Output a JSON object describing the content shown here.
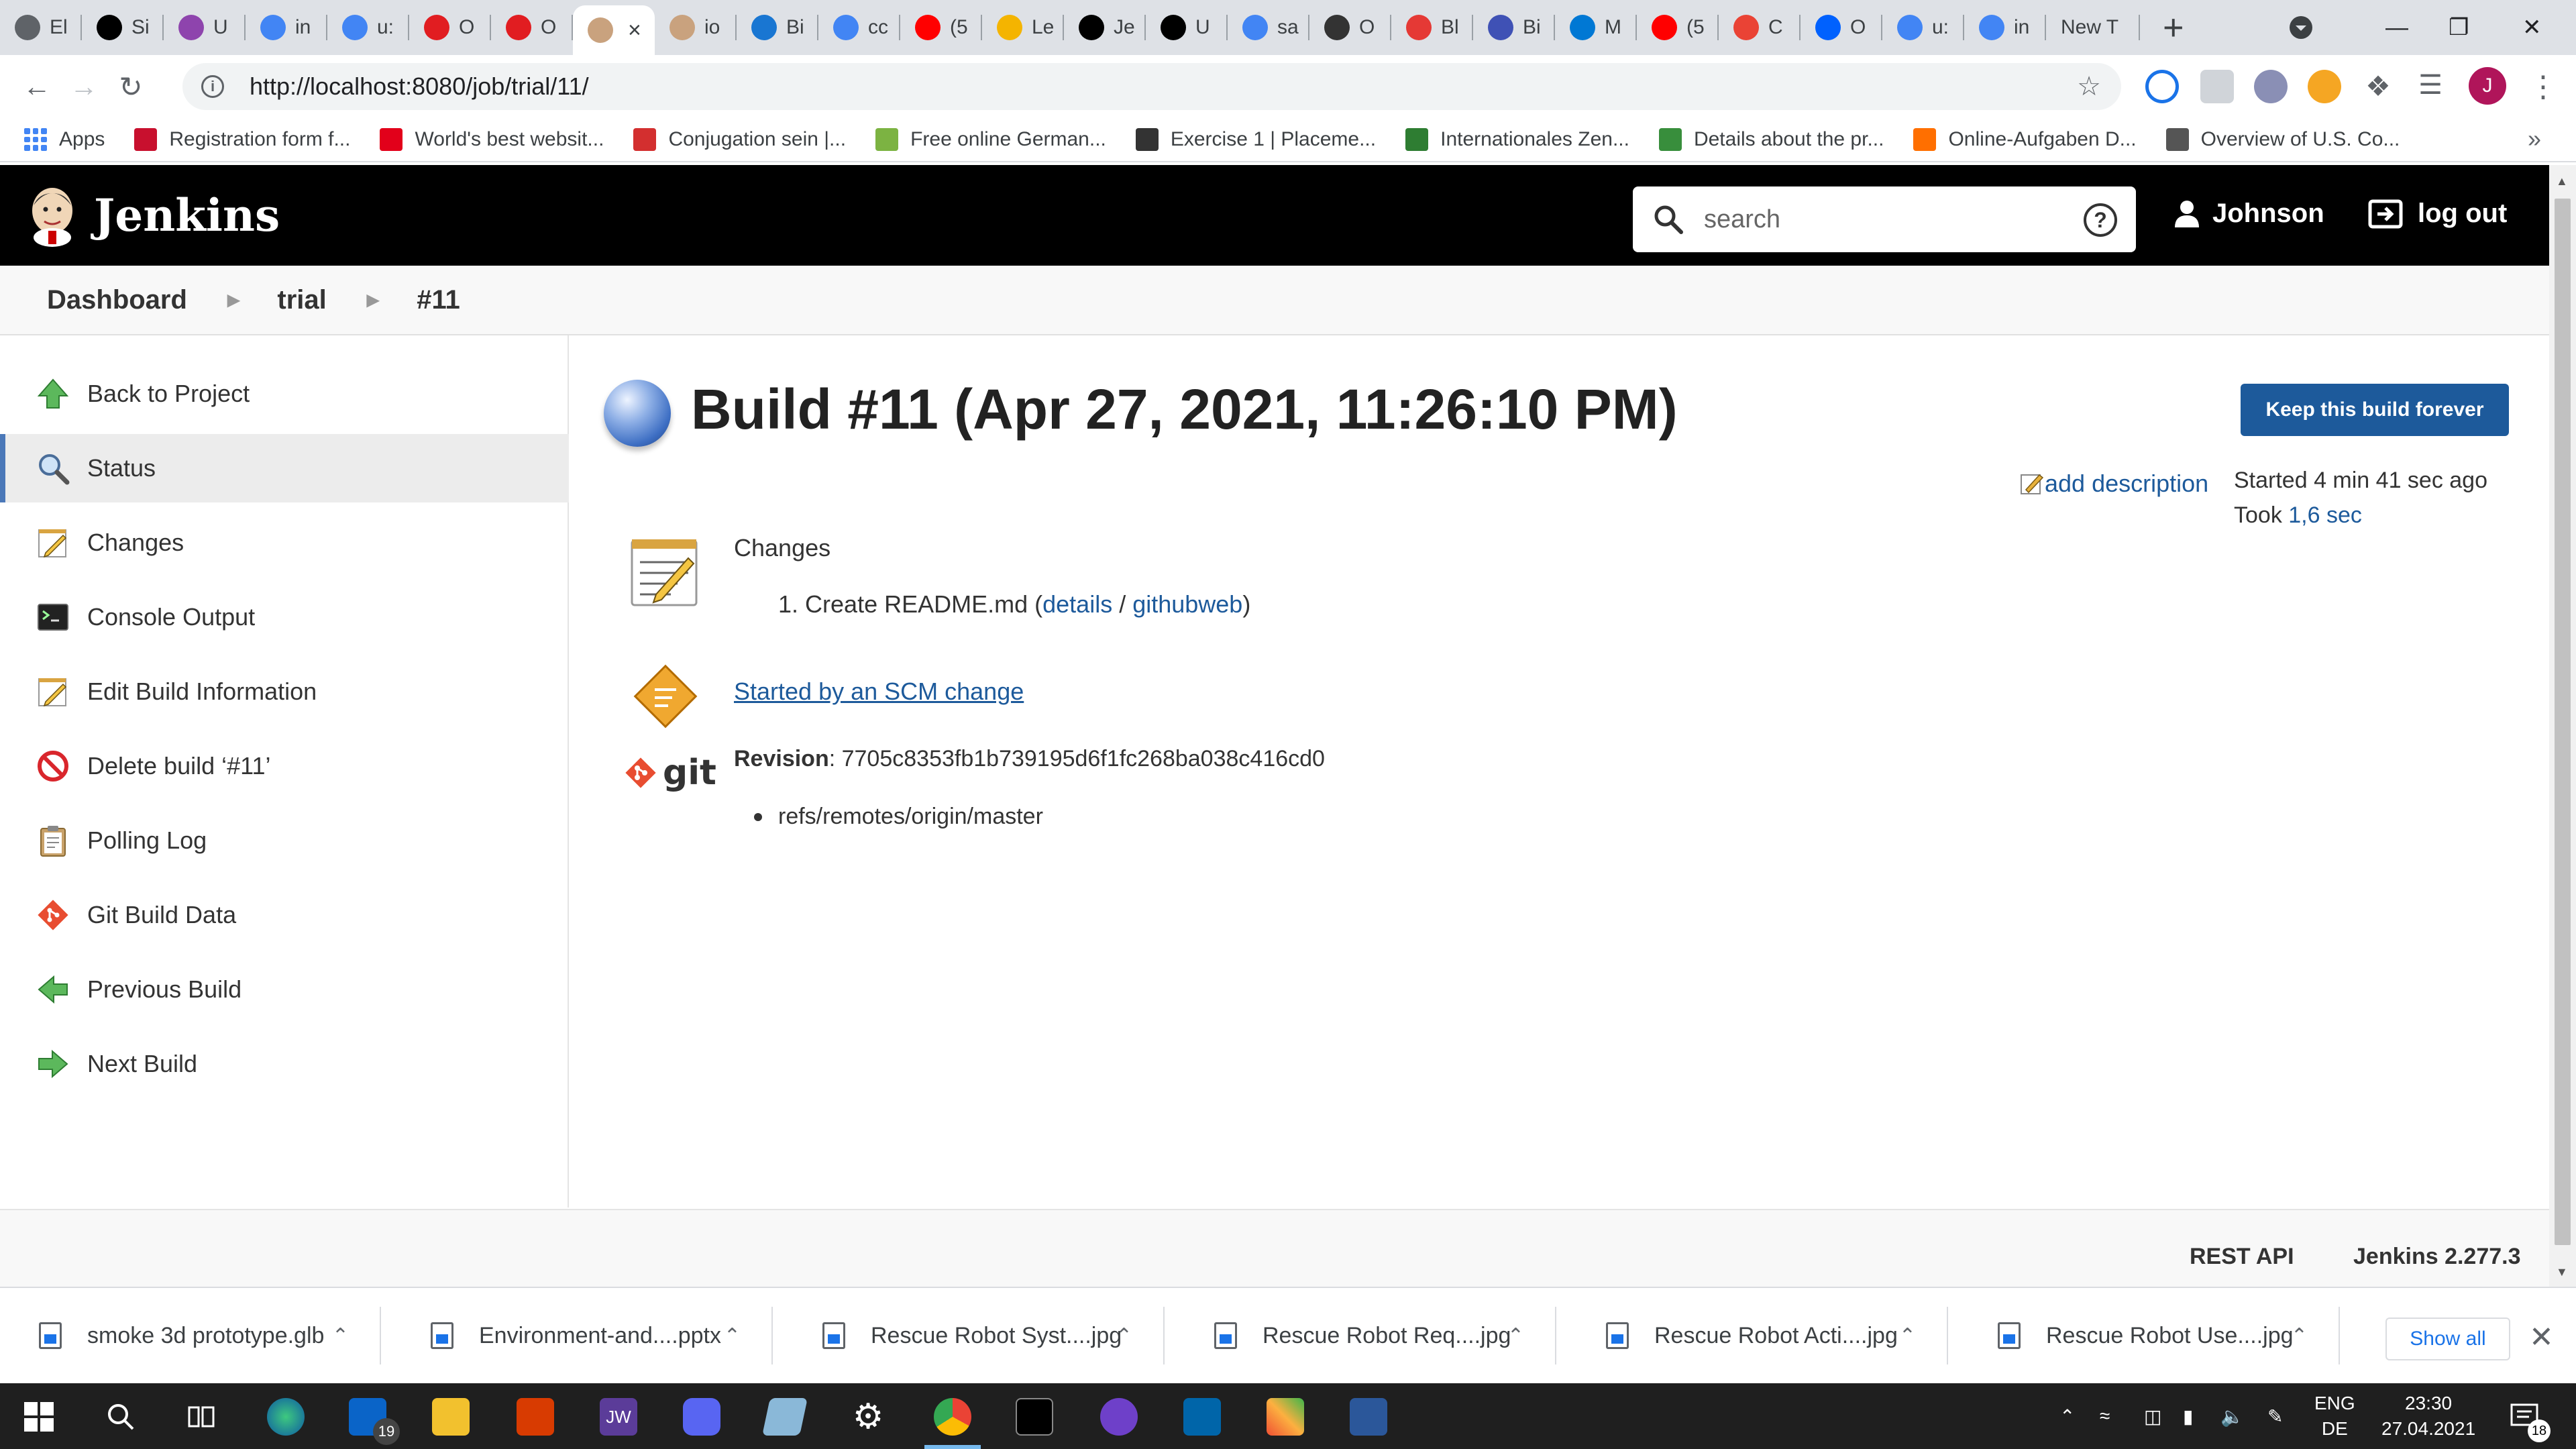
{
  "browser": {
    "tabs": [
      {
        "label": "El",
        "color": "#5f6368"
      },
      {
        "label": "Si",
        "color": "#000000"
      },
      {
        "label": "U",
        "color": "#8e44ad"
      },
      {
        "label": "in",
        "color": "#4285f4"
      },
      {
        "label": "u:",
        "color": "#4285f4"
      },
      {
        "label": "O",
        "color": "#e11d21"
      },
      {
        "label": "O",
        "color": "#e11d21"
      },
      {
        "label": "",
        "color": "#c9a27e",
        "active": true
      },
      {
        "label": "io",
        "color": "#c9a27e"
      },
      {
        "label": "Bi",
        "color": "#1976d2"
      },
      {
        "label": "cc",
        "color": "#4285f4"
      },
      {
        "label": "(5",
        "color": "#ff0000"
      },
      {
        "label": "Le",
        "color": "#f4b400"
      },
      {
        "label": "Je",
        "color": "#000000"
      },
      {
        "label": "U",
        "color": "#000000"
      },
      {
        "label": "sa",
        "color": "#4285f4"
      },
      {
        "label": "O",
        "color": "#333333"
      },
      {
        "label": "Bl",
        "color": "#e53935"
      },
      {
        "label": "Bi",
        "color": "#3f51b5"
      },
      {
        "label": "M",
        "color": "#0078d4"
      },
      {
        "label": "(5",
        "color": "#ff0000"
      },
      {
        "label": "C",
        "color": "#ea4335"
      },
      {
        "label": "O",
        "color": "#0061fe"
      },
      {
        "label": "u:",
        "color": "#4285f4"
      },
      {
        "label": "in",
        "color": "#4285f4"
      },
      {
        "label": "New T",
        "color": "",
        "newtab": true
      }
    ],
    "new_tab_symbol": "+",
    "window_controls": {
      "minimize": "—",
      "restore": "❐",
      "close": "✕"
    },
    "url": "http://localhost:8080/job/trial/11/",
    "bookmarks": [
      {
        "label": "Apps",
        "color": "#4285f4"
      },
      {
        "label": "Registration form f...",
        "color": "#c8102e"
      },
      {
        "label": "World's best websit...",
        "color": "#e2001a"
      },
      {
        "label": "Conjugation sein |...",
        "color": "#d32f2f"
      },
      {
        "label": "Free online German...",
        "color": "#7cb342"
      },
      {
        "label": "Exercise 1 | Placeme...",
        "color": "#333333"
      },
      {
        "label": "Internationales Zen...",
        "color": "#2e7d32"
      },
      {
        "label": "Details about the pr...",
        "color": "#388e3c"
      },
      {
        "label": "Online-Aufgaben D...",
        "color": "#ff6f00"
      },
      {
        "label": "Overview of U.S. Co...",
        "color": "#555555"
      }
    ],
    "bookmarks_more": "»",
    "profile_initial": "J"
  },
  "jenkins": {
    "brand": "Jenkins",
    "search_placeholder": "search",
    "help_symbol": "?",
    "user_name": "Johnson",
    "logout_label": "log out"
  },
  "breadcrumb": [
    "Dashboard",
    "trial",
    "#11"
  ],
  "side_tasks": [
    {
      "label": "Back to Project",
      "icon": "up-arrow-icon"
    },
    {
      "label": "Status",
      "icon": "magnifier-icon",
      "active": true
    },
    {
      "label": "Changes",
      "icon": "notepad-icon"
    },
    {
      "label": "Console Output",
      "icon": "terminal-icon"
    },
    {
      "label": "Edit Build Information",
      "icon": "notepad-icon"
    },
    {
      "label": "Delete build ‘#11’",
      "icon": "no-entry-icon"
    },
    {
      "label": "Polling Log",
      "icon": "clipboard-icon"
    },
    {
      "label": "Git Build Data",
      "icon": "git-icon"
    },
    {
      "label": "Previous Build",
      "icon": "left-arrow-icon"
    },
    {
      "label": "Next Build",
      "icon": "right-arrow-icon"
    }
  ],
  "build": {
    "title": "Build #11 (Apr 27, 2021, 11:26:10 PM)",
    "keep_label": "Keep this build forever",
    "add_description": "add description",
    "started": "Started 4 min 41 sec ago",
    "took_prefix": "Took ",
    "took_value": "1,6 sec",
    "changes_heading": "Changes",
    "change_number": "1.",
    "change_text": "Create README.md (",
    "change_details": "details",
    "change_sep": " / ",
    "change_githubweb": "githubweb",
    "change_close": ")",
    "cause": "Started by an SCM change",
    "git_label": "git",
    "revision_label": "Revision",
    "revision_value": ": 7705c8353fb1b739195d6f1fc268ba038c416cd0",
    "branch": "refs/remotes/origin/master"
  },
  "footer": {
    "rest_api": "REST API",
    "version": "Jenkins 2.277.3"
  },
  "downloads": {
    "items": [
      {
        "name": "smoke 3d prototype.glb"
      },
      {
        "name": "Environment-and....pptx"
      },
      {
        "name": "Rescue Robot Syst....jpg"
      },
      {
        "name": "Rescue Robot Req....jpg"
      },
      {
        "name": "Rescue Robot Acti....jpg"
      },
      {
        "name": "Rescue Robot Use....jpg"
      }
    ],
    "show_all": "Show all",
    "close_symbol": "✕"
  },
  "taskbar": {
    "mail_badge": "19",
    "lang_top": "ENG",
    "lang_bottom": "DE",
    "time": "23:30",
    "date": "27.04.2021",
    "notif_count": "18"
  }
}
